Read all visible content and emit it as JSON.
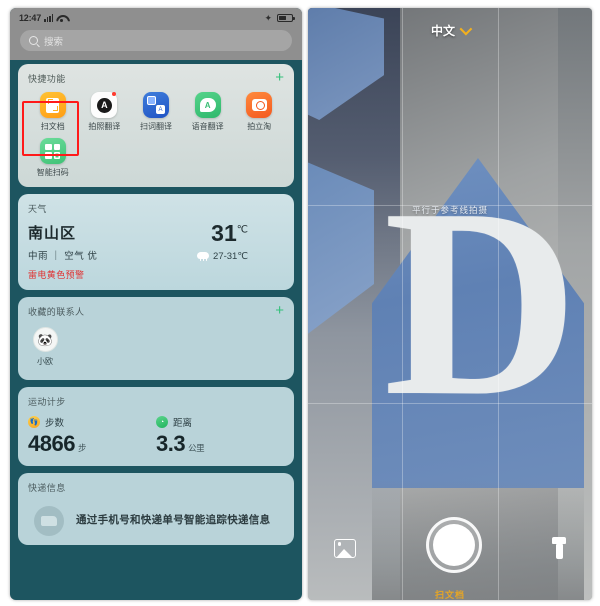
{
  "left_phone": {
    "status_bar": {
      "time": "12:47",
      "signal_icon": "signal-bars-icon",
      "wifi_icon": "wifi-icon",
      "bluetooth_icon": "✦",
      "battery_icon": "battery-icon"
    },
    "search": {
      "placeholder": "搜索",
      "icon": "search-icon"
    },
    "quick_functions": {
      "title": "快捷功能",
      "add_label": "+",
      "items": [
        {
          "label": "扫文档",
          "icon": "scan-document-icon",
          "highlighted": true
        },
        {
          "label": "拍照翻译",
          "icon": "photo-translate-icon",
          "badge": true,
          "glyph": "A"
        },
        {
          "label": "扫词翻译",
          "icon": "word-translate-icon",
          "glyph": "A"
        },
        {
          "label": "语音翻译",
          "icon": "voice-translate-icon",
          "glyph": "A"
        },
        {
          "label": "拍立淘",
          "icon": "taobao-camera-icon"
        },
        {
          "label": "智能扫码",
          "icon": "qr-scan-icon"
        }
      ]
    },
    "weather": {
      "title": "天气",
      "city": "南山区",
      "temperature": "31",
      "temperature_unit": "℃",
      "condition": "中雨 ｜ 空气 优",
      "range": "27-31℃",
      "range_icon": "rain-cloud-icon",
      "alert": "雷电黄色预警",
      "alert_color": "#e03131"
    },
    "contacts": {
      "title": "收藏的联系人",
      "add_label": "+",
      "items": [
        {
          "name": "小欧",
          "avatar_glyph": "🐼"
        }
      ]
    },
    "steps": {
      "title": "运动计步",
      "metrics": [
        {
          "label": "步数",
          "value": "4866",
          "unit": "步",
          "icon": "footprint-icon",
          "glyph": "👣"
        },
        {
          "label": "距离",
          "value": "3.3",
          "unit": "公里",
          "icon": "distance-icon",
          "glyph": "◔"
        }
      ]
    },
    "express": {
      "title": "快递信息",
      "icon": "delivery-truck-icon",
      "description": "通过手机号和快递单号智能追踪快递信息"
    }
  },
  "right_camera": {
    "language_selector": {
      "label": "中文",
      "chevron_icon": "chevron-down-icon",
      "chevron_color": "#f2b01e"
    },
    "hint": "平行于参考线拍摄",
    "scene": {
      "sign_letter": "D"
    },
    "bottom_bar": {
      "gallery_icon": "gallery-icon",
      "shutter_icon": "shutter-button",
      "torch_icon": "flashlight-icon"
    },
    "caption": "扫文档"
  }
}
